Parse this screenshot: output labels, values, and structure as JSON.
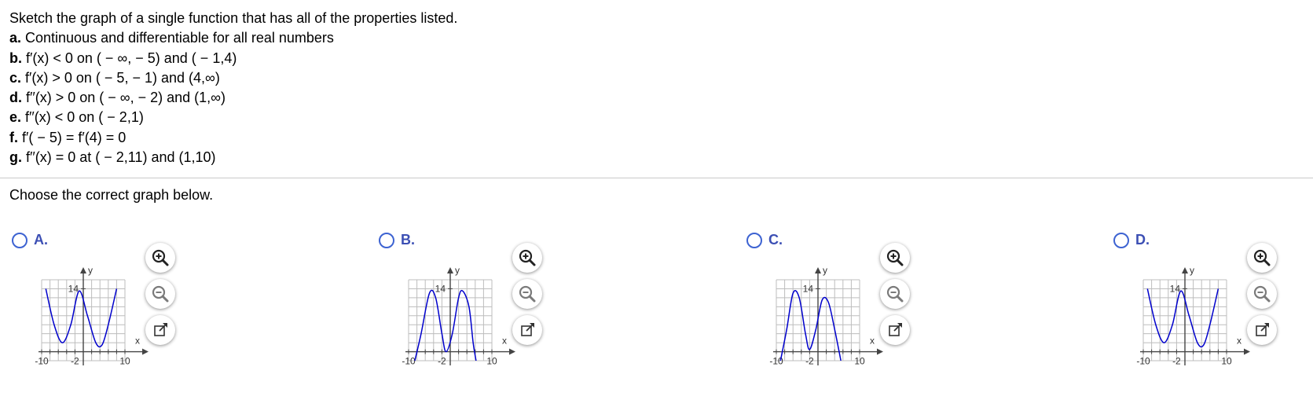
{
  "question": {
    "intro": "Sketch the graph of a single function that has all of the properties listed.",
    "properties": [
      {
        "label": "a.",
        "text": "Continuous and differentiable for all real numbers"
      },
      {
        "label": "b.",
        "text": "f′(x) < 0 on ( − ∞, − 5) and ( − 1,4)"
      },
      {
        "label": "c.",
        "text": "f′(x) > 0 on ( − 5, − 1) and (4,∞)"
      },
      {
        "label": "d.",
        "text": "f′′(x) > 0 on ( − ∞, − 2) and (1,∞)"
      },
      {
        "label": "e.",
        "text": "f′′(x) < 0 on ( − 2,1)"
      },
      {
        "label": "f.",
        "text": "f′( − 5) = f′(4) = 0"
      },
      {
        "label": "g.",
        "text": "f′′(x) = 0 at ( − 2,11) and (1,10)"
      }
    ]
  },
  "prompt": "Choose the correct graph below.",
  "axis_labels": {
    "x": "x",
    "y": "y",
    "xmin": "-10",
    "xmid": "-2",
    "xmax": "10",
    "ymark": "14"
  },
  "colors": {
    "curve": "#0000cc",
    "radio": "#3d63d2",
    "letter": "#3c4fb4",
    "grid": "#bdbdbd",
    "axis": "#444444"
  },
  "tool_icons": [
    "zoom-in-icon",
    "zoom-out-icon",
    "popout-icon"
  ],
  "choices": [
    {
      "letter": "A.",
      "shape": "W",
      "xlim": [
        -10,
        10
      ],
      "ylim": [
        -2,
        16
      ],
      "points": [
        [
          -9,
          14
        ],
        [
          -7,
          6
        ],
        [
          -5,
          2
        ],
        [
          -3,
          6
        ],
        [
          -1,
          13.5
        ],
        [
          1,
          8
        ],
        [
          3,
          2
        ],
        [
          4.5,
          1.5
        ],
        [
          6,
          6
        ],
        [
          8,
          14
        ]
      ]
    },
    {
      "letter": "B.",
      "shape": "M",
      "xlim": [
        -10,
        10
      ],
      "ylim": [
        -2,
        16
      ],
      "points": [
        [
          -8.5,
          -2
        ],
        [
          -7,
          4
        ],
        [
          -5,
          13
        ],
        [
          -3.5,
          12
        ],
        [
          -2,
          4
        ],
        [
          -1,
          0
        ],
        [
          0.5,
          4
        ],
        [
          2,
          12
        ],
        [
          3,
          13.5
        ],
        [
          4.5,
          10
        ],
        [
          5.5,
          2
        ],
        [
          6.2,
          -2
        ]
      ]
    },
    {
      "letter": "C.",
      "shape": "M",
      "xlim": [
        -10,
        10
      ],
      "ylim": [
        -2,
        16
      ],
      "points": [
        [
          -9,
          -2
        ],
        [
          -7.5,
          5
        ],
        [
          -6,
          13
        ],
        [
          -4.5,
          12
        ],
        [
          -3,
          4
        ],
        [
          -2,
          0.5
        ],
        [
          -0.5,
          5
        ],
        [
          1,
          11.5
        ],
        [
          2.5,
          11
        ],
        [
          4,
          5
        ],
        [
          5.5,
          -2
        ]
      ]
    },
    {
      "letter": "D.",
      "shape": "W",
      "xlim": [
        -10,
        10
      ],
      "ylim": [
        -2,
        16
      ],
      "points": [
        [
          -9,
          14
        ],
        [
          -7,
          6
        ],
        [
          -5,
          2
        ],
        [
          -3,
          6
        ],
        [
          -1,
          13.5
        ],
        [
          1,
          8
        ],
        [
          3,
          2
        ],
        [
          4.5,
          1.5
        ],
        [
          6,
          6
        ],
        [
          8,
          14
        ]
      ]
    }
  ]
}
